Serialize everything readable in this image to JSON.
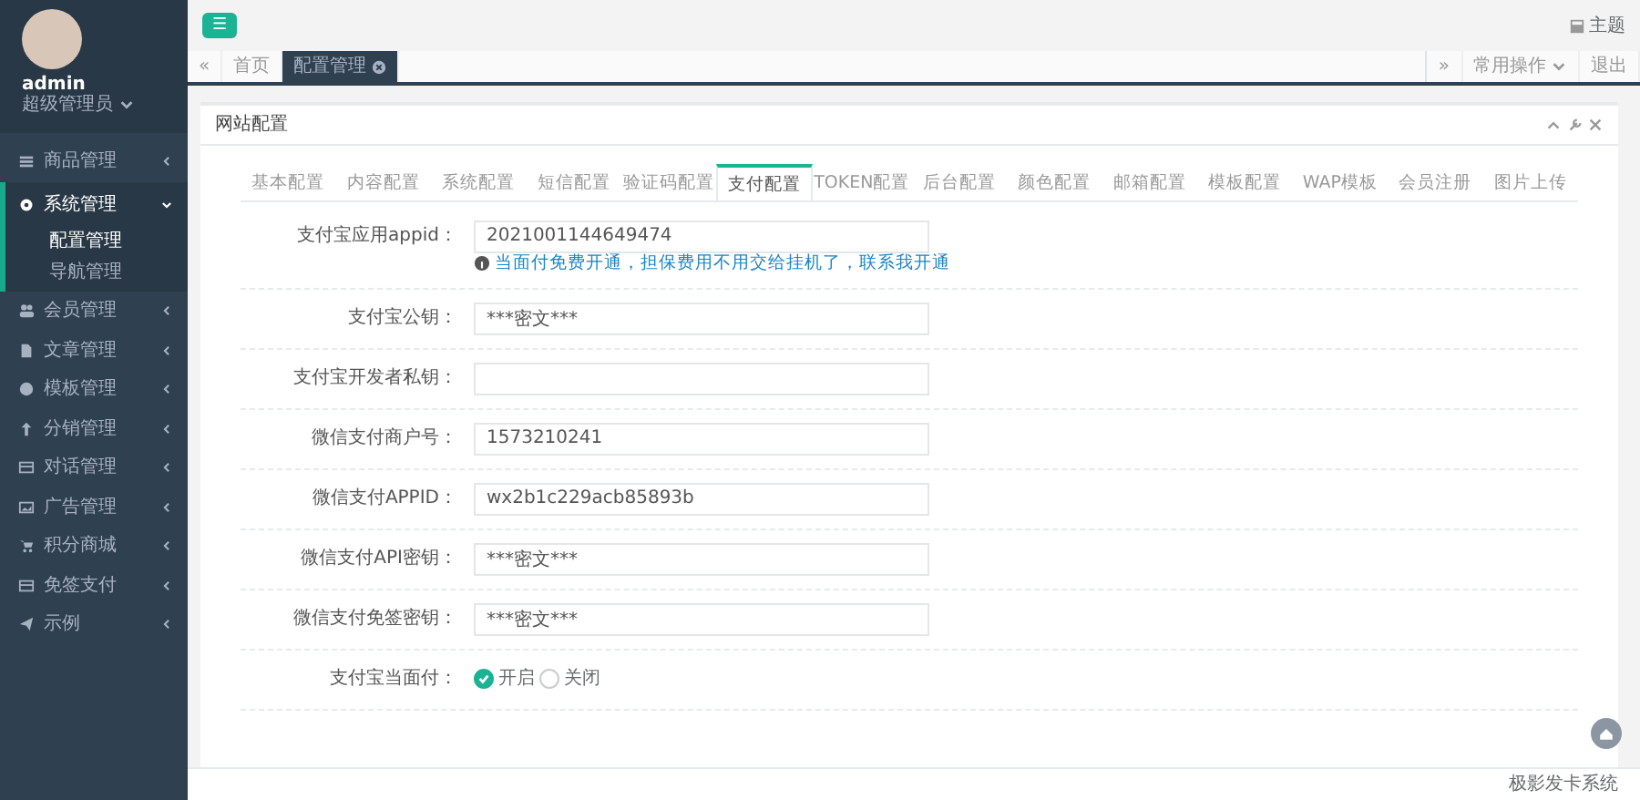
{
  "profile": {
    "name": "admin",
    "role": "超级管理员"
  },
  "sidebar": {
    "items": [
      {
        "label": "商品管理",
        "expanded": false
      },
      {
        "label": "系统管理",
        "expanded": true,
        "children": [
          {
            "label": "配置管理",
            "selected": true
          },
          {
            "label": "导航管理",
            "selected": false
          }
        ]
      },
      {
        "label": "会员管理",
        "expanded": false
      },
      {
        "label": "文章管理",
        "expanded": false
      },
      {
        "label": "模板管理",
        "expanded": false
      },
      {
        "label": "分销管理",
        "expanded": false
      },
      {
        "label": "对话管理",
        "expanded": false
      },
      {
        "label": "广告管理",
        "expanded": false
      },
      {
        "label": "积分商城",
        "expanded": false
      },
      {
        "label": "免签支付",
        "expanded": false
      },
      {
        "label": "示例",
        "expanded": false
      }
    ]
  },
  "topbar": {
    "menu_glyph": "☰",
    "theme": "主题"
  },
  "page_tabs": {
    "back": "«",
    "items": [
      {
        "label": "首页",
        "selected": false,
        "closable": false
      },
      {
        "label": "配置管理",
        "selected": true,
        "closable": true
      }
    ],
    "forward": "»",
    "ops": "常用操作",
    "logout": "退出"
  },
  "panel": {
    "title": "网站配置",
    "tabs": [
      {
        "label": "基本配置",
        "selected": false
      },
      {
        "label": "内容配置",
        "selected": false
      },
      {
        "label": "系统配置",
        "selected": false
      },
      {
        "label": "短信配置",
        "selected": false
      },
      {
        "label": "验证码配置",
        "selected": false
      },
      {
        "label": "支付配置",
        "selected": true
      },
      {
        "label": "TOKEN配置",
        "selected": false
      },
      {
        "label": "后台配置",
        "selected": false
      },
      {
        "label": "颜色配置",
        "selected": false
      },
      {
        "label": "邮箱配置",
        "selected": false
      },
      {
        "label": "模板配置",
        "selected": false
      },
      {
        "label": "WAP模板",
        "selected": false
      },
      {
        "label": "会员注册",
        "selected": false
      },
      {
        "label": "图片上传",
        "selected": false
      }
    ],
    "fields": [
      {
        "kind": "text",
        "label": "支付宝应用appid：",
        "value": "2021001144649474",
        "hint": "当面付免费开通，担保费用不用交给挂机了，联系我开通"
      },
      {
        "kind": "text",
        "label": "支付宝公钥：",
        "value": "***密文***"
      },
      {
        "kind": "text",
        "label": "支付宝开发者私钥："
      },
      {
        "kind": "text",
        "label": "微信支付商户号：",
        "value": "1573210241"
      },
      {
        "kind": "text",
        "label": "微信支付APPID：",
        "value": "wx2b1c229acb85893b"
      },
      {
        "kind": "text",
        "label": "微信支付API密钥：",
        "value": "***密文***"
      },
      {
        "kind": "text",
        "label": "微信支付免签密钥：",
        "value": "***密文***"
      },
      {
        "kind": "radio",
        "label": "支付宝当面付：",
        "options": [
          {
            "label": "开启",
            "selected": true
          },
          {
            "label": "关闭",
            "selected": false
          }
        ]
      }
    ]
  },
  "footer": "极影发卡系统"
}
